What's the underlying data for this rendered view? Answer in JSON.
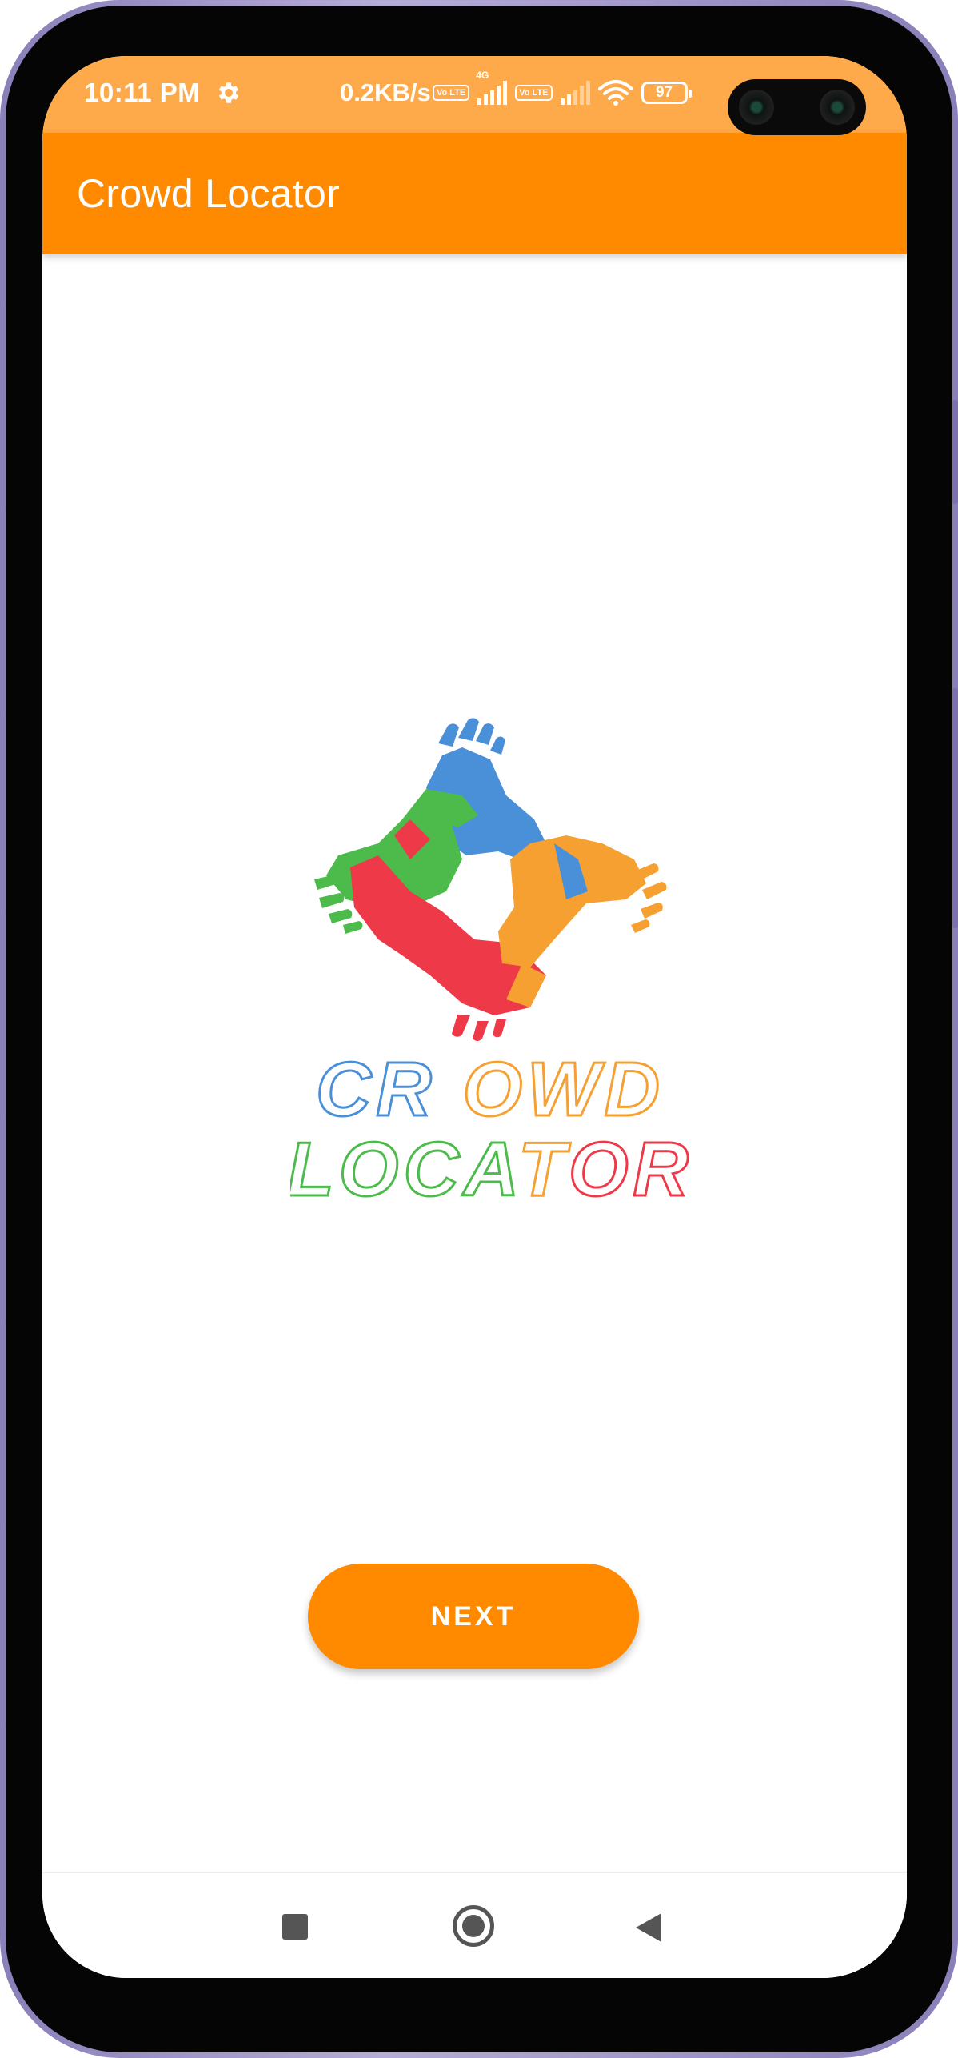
{
  "status_bar": {
    "time": "10:11 PM",
    "network_speed": "0.2KB/s",
    "sim1_badge": "Vo LTE",
    "sim1_type": "4G",
    "sim2_badge": "Vo LTE",
    "battery_level": "97",
    "icons": [
      "gear-icon",
      "volte-icon",
      "signal-icon",
      "wifi-icon",
      "battery-icon"
    ]
  },
  "app_bar": {
    "title": "Crowd Locator"
  },
  "logo": {
    "line1": "CROWD",
    "line2": "LOCATOR",
    "colors": {
      "blue": "#4a90d9",
      "green": "#4cbb4c",
      "orange": "#f5a031",
      "red": "#ee3a48"
    }
  },
  "main": {
    "next_label": "NEXT"
  },
  "nav_bar": {
    "icons": [
      "recent-apps-icon",
      "home-icon",
      "back-icon"
    ]
  },
  "theme": {
    "primary": "#ff8a00",
    "status_bar": "#ffaa4a"
  }
}
